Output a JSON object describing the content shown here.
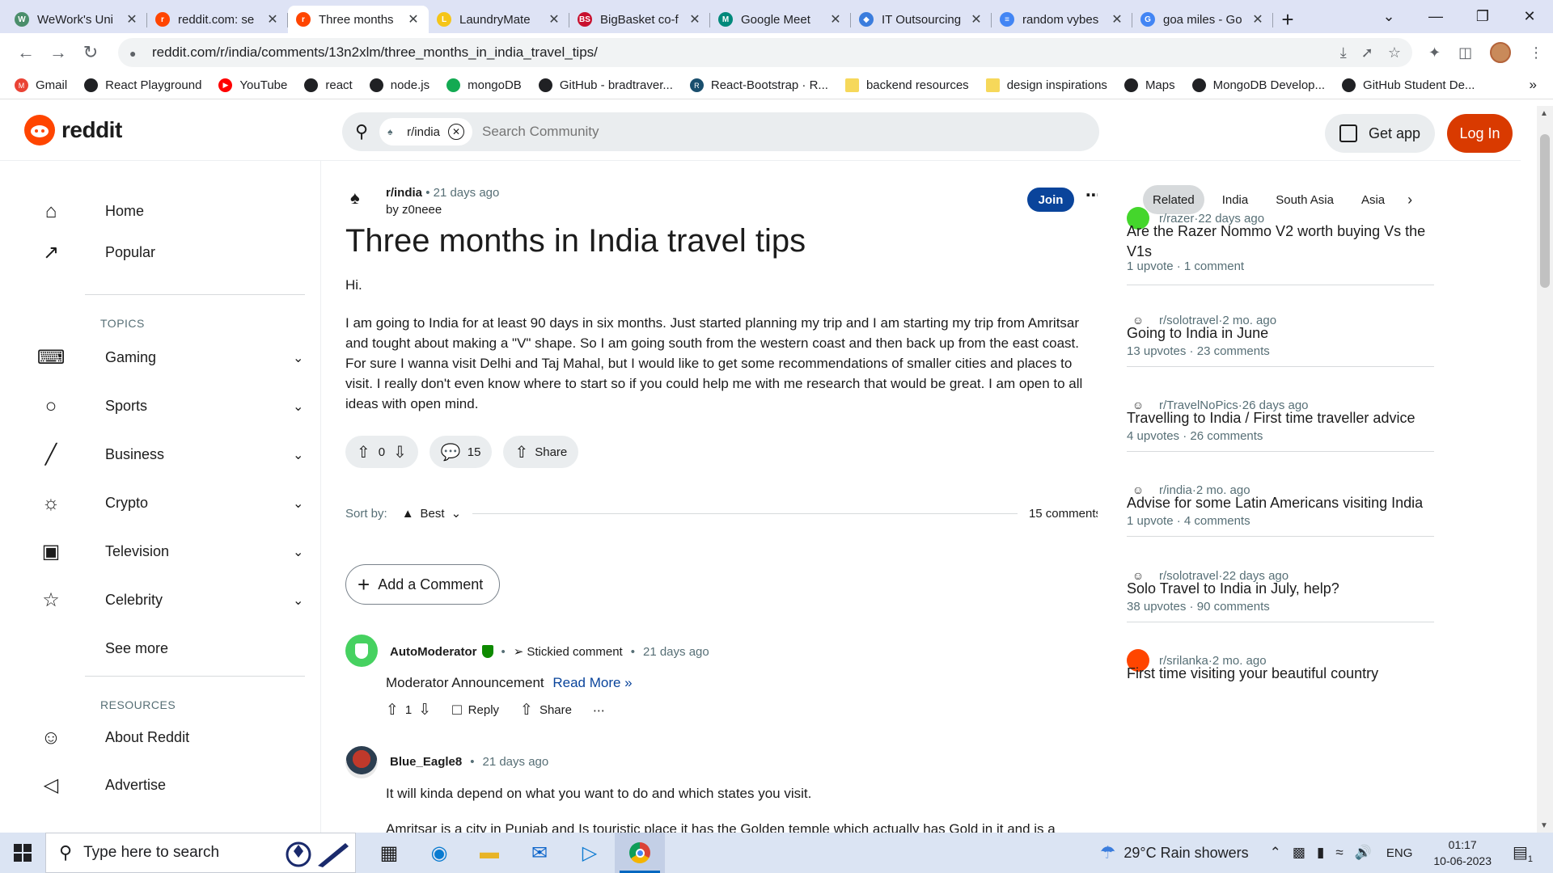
{
  "browser": {
    "tabs": [
      {
        "title": "WeWork's Uni",
        "color": "#4b8e6b",
        "glyph": "W",
        "active": false
      },
      {
        "title": "reddit.com: se",
        "color": "#ff4500",
        "glyph": "r",
        "active": false
      },
      {
        "title": "Three months",
        "color": "#ff4500",
        "glyph": "r",
        "active": true
      },
      {
        "title": "LaundryMate",
        "color": "#f5c518",
        "glyph": "L",
        "active": false
      },
      {
        "title": "BigBasket co-f",
        "color": "#c8102e",
        "glyph": "BS",
        "active": false
      },
      {
        "title": "Google Meet",
        "color": "#00897b",
        "glyph": "M",
        "active": false
      },
      {
        "title": "IT Outsourcing",
        "color": "#3b7ddd",
        "glyph": "◆",
        "active": false
      },
      {
        "title": "random vybes",
        "color": "#4285f4",
        "glyph": "≡",
        "active": false
      },
      {
        "title": "goa miles - Go",
        "color": "#4285f4",
        "glyph": "G",
        "active": false
      }
    ],
    "url": "reddit.com/r/india/comments/13n2xlm/three_months_in_india_travel_tips/",
    "bookmarks": [
      {
        "label": "Gmail",
        "icon": "gmail-icon",
        "color": "#ea4335",
        "glyph": "M"
      },
      {
        "label": "React Playground",
        "icon": "globe-icon",
        "color": "#202124",
        "glyph": ""
      },
      {
        "label": "YouTube",
        "icon": "youtube-icon",
        "color": "#ff0000",
        "glyph": "▶"
      },
      {
        "label": "react",
        "icon": "globe-icon",
        "color": "#202124",
        "glyph": ""
      },
      {
        "label": "node.js",
        "icon": "globe-icon",
        "color": "#202124",
        "glyph": ""
      },
      {
        "label": "mongoDB",
        "icon": "mongodb-icon",
        "color": "#13aa52",
        "glyph": ""
      },
      {
        "label": "GitHub - bradtraver...",
        "icon": "github-icon",
        "color": "#202124",
        "glyph": ""
      },
      {
        "label": "React-Bootstrap · R...",
        "icon": "react-bootstrap-icon",
        "color": "#1a4f6e",
        "glyph": "R"
      },
      {
        "label": "backend resources",
        "icon": "folder-icon",
        "color": "#f6d85a",
        "glyph": ""
      },
      {
        "label": "design inspirations",
        "icon": "folder-icon",
        "color": "#f6d85a",
        "glyph": ""
      },
      {
        "label": "Maps",
        "icon": "globe-icon",
        "color": "#202124",
        "glyph": ""
      },
      {
        "label": "MongoDB Develop...",
        "icon": "globe-icon",
        "color": "#202124",
        "glyph": ""
      },
      {
        "label": "GitHub Student De...",
        "icon": "globe-icon",
        "color": "#202124",
        "glyph": ""
      }
    ]
  },
  "reddit": {
    "logo_text": "reddit",
    "search_chip": "r/india",
    "search_placeholder": "Search Community",
    "get_app": "Get app",
    "login": "Log In",
    "accent": "#d93a00"
  },
  "sidebar": {
    "top": [
      {
        "label": "Home",
        "icon": "home-icon",
        "glyph": "⌂"
      },
      {
        "label": "Popular",
        "icon": "popular-icon",
        "glyph": "↗"
      }
    ],
    "topics_heading": "TOPICS",
    "topics": [
      {
        "label": "Gaming",
        "icon": "gamepad-icon",
        "glyph": "⌨"
      },
      {
        "label": "Sports",
        "icon": "ball-icon",
        "glyph": "○"
      },
      {
        "label": "Business",
        "icon": "chart-icon",
        "glyph": "╱"
      },
      {
        "label": "Crypto",
        "icon": "crypto-icon",
        "glyph": "☼"
      },
      {
        "label": "Television",
        "icon": "tv-icon",
        "glyph": "▣"
      },
      {
        "label": "Celebrity",
        "icon": "star-icon",
        "glyph": "☆"
      }
    ],
    "see_more": "See more",
    "resources_heading": "RESOURCES",
    "resources": [
      {
        "label": "About Reddit",
        "icon": "reddit-alien-icon",
        "glyph": "☺"
      },
      {
        "label": "Advertise",
        "icon": "megaphone-icon",
        "glyph": "◁"
      }
    ]
  },
  "post": {
    "subreddit": "r/india",
    "age": "21 days ago",
    "author": "by z0neee",
    "join": "Join",
    "title": "Three months in India travel tips",
    "greeting": "Hi.",
    "body": "I am going to India for at least 90 days in six months. Just started planning my trip and I am starting my trip from Amritsar and tought about making a \"V\" shape. So I am going south from the western coast and then back up from the east coast. For sure I wanna visit Delhi and Taj Mahal, but I would like to get some recommendations of smaller cities and places to visit. I really don't even know where to start so if you could help me with me research that would be great. I am open to all ideas with open mind.",
    "votes": "0",
    "comments_count": "15",
    "share": "Share",
    "sort_label": "Sort by:",
    "sort_value": "Best",
    "comments_total": "15 comments",
    "add_comment": "Add a Comment"
  },
  "comments": [
    {
      "user": "AutoModerator",
      "badge": "Stickied comment",
      "age": "21 days ago",
      "text": "Moderator Announcement",
      "link": "Read More »",
      "votes": "1",
      "reply": "Reply",
      "share": "Share"
    },
    {
      "user": "Blue_Eagle8",
      "age": "21 days ago",
      "text": "It will kinda depend on what you want to do and which states you visit.",
      "text2": "Amritsar is a city in Punjab and Is touristic place it has the Golden temple which actually has Gold in it and is a"
    }
  ],
  "related": {
    "tabs": [
      "Related",
      "India",
      "South Asia",
      "Asia"
    ],
    "items": [
      {
        "sub": "r/razer",
        "age": "22 days ago",
        "title": "Are the Razer Nommo V2 worth buying Vs the V1s",
        "upvotes": "1 upvote",
        "comments": "1 comment",
        "color": "#44d62c"
      },
      {
        "sub": "r/solotravel",
        "age": "2 mo. ago",
        "title": "Going to India in June",
        "upvotes": "13 upvotes",
        "comments": "23 comments",
        "color": "#ffffff"
      },
      {
        "sub": "r/TravelNoPics",
        "age": "26 days ago",
        "title": "Travelling to India / First time traveller advice",
        "upvotes": "4 upvotes",
        "comments": "26 comments",
        "color": "#ffffff"
      },
      {
        "sub": "r/india",
        "age": "2 mo. ago",
        "title": "Advise for some Latin Americans visiting India",
        "upvotes": "1 upvote",
        "comments": "4 comments",
        "color": "#ffffff"
      },
      {
        "sub": "r/solotravel",
        "age": "22 days ago",
        "title": "Solo Travel to India in July, help?",
        "upvotes": "38 upvotes",
        "comments": "90 comments",
        "color": "#ffffff"
      },
      {
        "sub": "r/srilanka",
        "age": "2 mo. ago",
        "title": "First time visiting your beautiful country",
        "upvotes": "",
        "comments": "",
        "color": "#ff4500"
      }
    ]
  },
  "taskbar": {
    "search_placeholder": "Type here to search",
    "weather": "29°C  Rain showers",
    "lang": "ENG",
    "time": "01:17",
    "date": "10-06-2023",
    "notifications": "1"
  }
}
